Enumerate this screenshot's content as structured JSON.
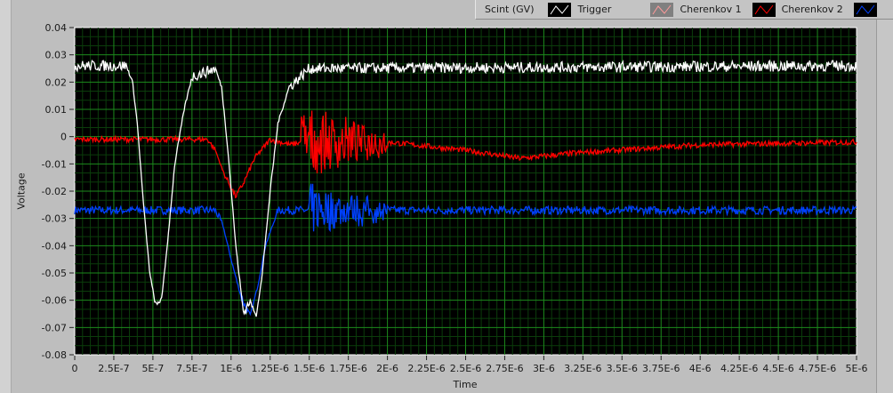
{
  "legend": {
    "items": [
      {
        "label": "Scint (GV)",
        "color": "#ffffff",
        "swatch_bg": "#000000"
      },
      {
        "label": "Trigger",
        "color": "#ff8080",
        "swatch_bg": "#808080"
      },
      {
        "label": "Cherenkov 1",
        "color": "#ff0000",
        "swatch_bg": "#000000"
      },
      {
        "label": "Cherenkov 2",
        "color": "#0040ff",
        "swatch_bg": "#000000"
      }
    ]
  },
  "colors": {
    "plot_bg": "#000000",
    "grid_major": "#1c8a1c",
    "grid_minor": "#0b3d0b"
  },
  "chart_data": {
    "type": "line",
    "xlabel": "Time",
    "ylabel": "Voltage",
    "xlim": [
      0,
      5e-06
    ],
    "ylim": [
      -0.08,
      0.04
    ],
    "grid": true,
    "legend_placement": "top-right",
    "x_ticks": [
      "0",
      "2.5E-7",
      "5E-7",
      "7.5E-7",
      "1E-6",
      "1.25E-6",
      "1.5E-6",
      "1.75E-6",
      "2E-6",
      "2.25E-6",
      "2.5E-6",
      "2.75E-6",
      "3E-6",
      "3.25E-6",
      "3.5E-6",
      "3.75E-6",
      "4E-6",
      "4.25E-6",
      "4.5E-6",
      "4.75E-6",
      "5E-6"
    ],
    "y_ticks": [
      "0.04",
      "0.03",
      "0.02",
      "0.01",
      "0",
      "-0.01",
      "-0.02",
      "-0.03",
      "-0.04",
      "-0.05",
      "-0.06",
      "-0.07",
      "-0.08"
    ],
    "time_unit_us_note": "series x values in microseconds",
    "series": [
      {
        "name": "Scint (GV)",
        "color": "#ffffff",
        "noise": 0.002,
        "x": [
          0,
          0.33,
          0.37,
          0.4,
          0.44,
          0.48,
          0.52,
          0.56,
          0.6,
          0.64,
          0.7,
          0.75,
          0.9,
          0.94,
          0.98,
          1.03,
          1.08,
          1.12,
          1.16,
          1.2,
          1.25,
          1.3,
          1.37,
          1.5,
          5.0
        ],
        "y": [
          0.026,
          0.026,
          0.02,
          0.005,
          -0.025,
          -0.05,
          -0.063,
          -0.058,
          -0.035,
          -0.01,
          0.01,
          0.022,
          0.025,
          0.018,
          -0.005,
          -0.04,
          -0.065,
          -0.06,
          -0.066,
          -0.05,
          -0.02,
          0.005,
          0.018,
          0.025,
          0.026
        ]
      },
      {
        "name": "Trigger",
        "color": "#ff8080",
        "x": [],
        "y": []
      },
      {
        "name": "Cherenkov 1",
        "color": "#ff0000",
        "noise": 0.001,
        "x": [
          0,
          0.85,
          0.9,
          0.95,
          1.03,
          1.08,
          1.15,
          1.25,
          1.38,
          1.45,
          1.9,
          2.0,
          2.5,
          2.85,
          3.2,
          4.0,
          5.0
        ],
        "y": [
          -0.001,
          -0.001,
          -0.005,
          -0.013,
          -0.022,
          -0.017,
          -0.008,
          -0.001,
          -0.003,
          -0.002,
          -0.002,
          -0.002,
          -0.005,
          -0.008,
          -0.006,
          -0.003,
          -0.002
        ],
        "burst": {
          "start": 1.45,
          "end": 2.0,
          "amplitude": 0.013
        }
      },
      {
        "name": "Cherenkov 2",
        "color": "#0040ff",
        "noise": 0.0015,
        "x": [
          0,
          0.9,
          0.95,
          1.0,
          1.06,
          1.12,
          1.17,
          1.22,
          1.3,
          5.0
        ],
        "y": [
          -0.027,
          -0.027,
          -0.033,
          -0.045,
          -0.058,
          -0.066,
          -0.055,
          -0.04,
          -0.027,
          -0.027
        ],
        "burst": {
          "start": 1.5,
          "end": 2.0,
          "amplitude": 0.009
        }
      }
    ]
  }
}
